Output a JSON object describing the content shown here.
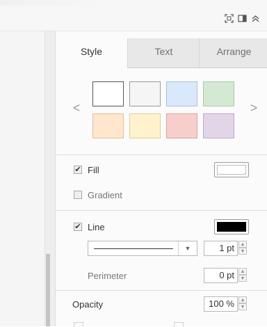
{
  "topbar": {
    "icons": [
      "fit-icon",
      "format-panel-icon",
      "collapse-icon"
    ]
  },
  "tabs": [
    {
      "label": "Style",
      "active": true
    },
    {
      "label": "Text",
      "active": false
    },
    {
      "label": "Arrange",
      "active": false
    }
  ],
  "swatches": {
    "prev_label": "<",
    "next_label": ">",
    "items": [
      {
        "fill": "#ffffff",
        "stroke": "#555555"
      },
      {
        "fill": "#f5f5f5",
        "stroke": "#9a9a9a"
      },
      {
        "fill": "#dae8fc",
        "stroke": "#a8bfe0"
      },
      {
        "fill": "#d5e8d4",
        "stroke": "#a7c9a5"
      },
      {
        "fill": "#ffe6cc",
        "stroke": "#e0bf98"
      },
      {
        "fill": "#fff2cc",
        "stroke": "#e0cf96"
      },
      {
        "fill": "#f8cecc",
        "stroke": "#d9a3a0"
      },
      {
        "fill": "#e1d5e7",
        "stroke": "#bcaac6"
      }
    ]
  },
  "fill": {
    "checkbox_checked": true,
    "label": "Fill",
    "color": "#ffffff"
  },
  "gradient": {
    "checkbox_checked": false,
    "label": "Gradient"
  },
  "line": {
    "checkbox_checked": true,
    "label": "Line",
    "color": "#000000",
    "style": "solid",
    "width_value": "1 pt"
  },
  "perimeter": {
    "label": "Perimeter",
    "value": "0 pt"
  },
  "opacity": {
    "label": "Opacity",
    "value": "100 %"
  }
}
